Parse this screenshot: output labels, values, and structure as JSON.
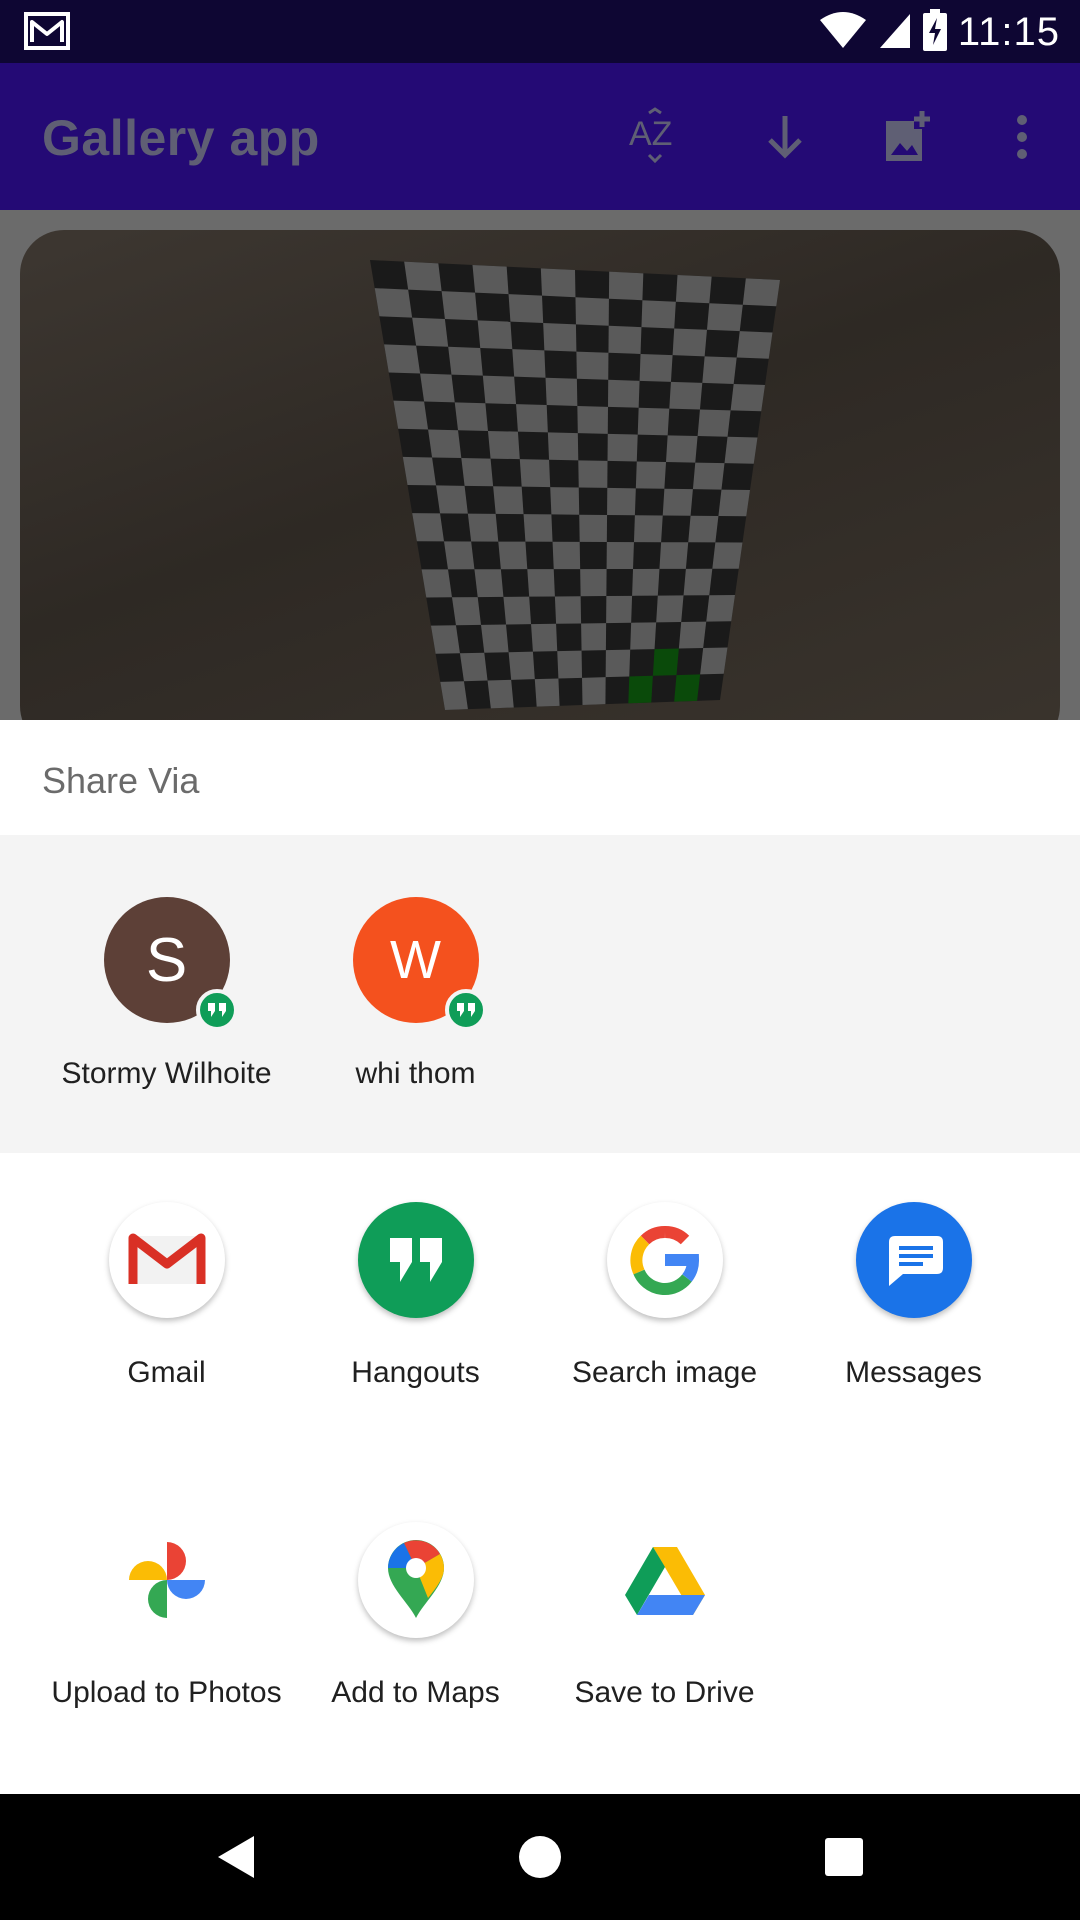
{
  "status_bar": {
    "time": "11:15",
    "icons": [
      "gmail-notification-icon",
      "wifi-icon",
      "signal-icon",
      "battery-charging-icon"
    ]
  },
  "app_bar": {
    "title": "Gallery app",
    "actions": [
      "sort-az-icon",
      "download-icon",
      "add-photo-icon",
      "more-vert-icon"
    ]
  },
  "share_sheet": {
    "title": "Share Via",
    "direct_targets": [
      {
        "initial": "S",
        "name": "Stormy Wilhoite",
        "color": "#5d4037"
      },
      {
        "initial": "W",
        "name": "whi thom",
        "color": "#f4511e"
      }
    ],
    "apps_row1": [
      {
        "label": "Gmail",
        "icon": "gmail-icon"
      },
      {
        "label": "Hangouts",
        "icon": "hangouts-icon"
      },
      {
        "label": "Search image",
        "icon": "google-icon"
      },
      {
        "label": "Messages",
        "icon": "messages-icon"
      }
    ],
    "apps_row2": [
      {
        "label": "Upload to Photos",
        "icon": "photos-icon"
      },
      {
        "label": "Add to Maps",
        "icon": "maps-icon"
      },
      {
        "label": "Save to Drive",
        "icon": "drive-icon"
      }
    ]
  },
  "nav_bar": {
    "buttons": [
      "back-icon",
      "home-icon",
      "recents-icon"
    ]
  },
  "colors": {
    "status_bar": "#0e0633",
    "app_bar": "#240a75",
    "hangouts_green": "#0f9d58",
    "messages_blue": "#1a73e8"
  }
}
